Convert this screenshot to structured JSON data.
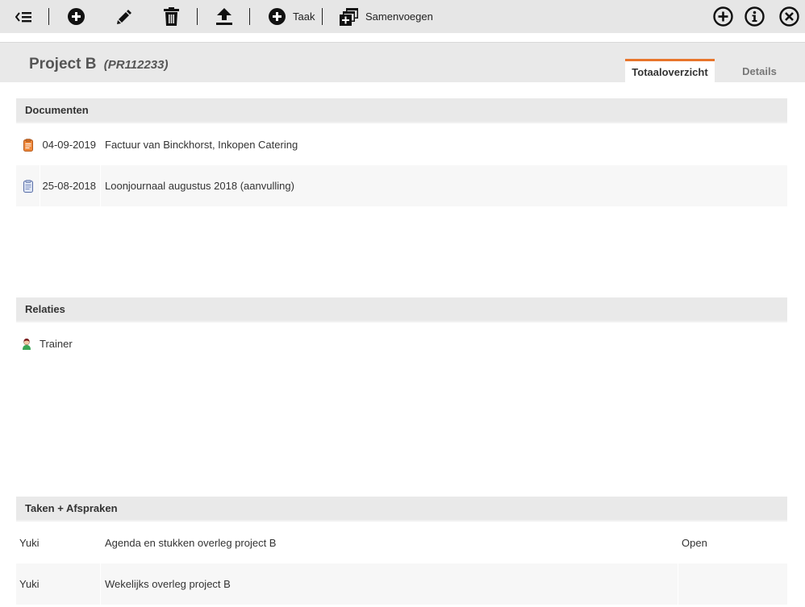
{
  "toolbar": {
    "task_label": "Taak",
    "merge_label": "Samenvoegen"
  },
  "header": {
    "title": "Project B",
    "code": "(PR112233)",
    "tabs": [
      {
        "label": "Totaaloverzicht",
        "active": true
      },
      {
        "label": "Details",
        "active": false
      }
    ]
  },
  "documents": {
    "heading": "Documenten",
    "rows": [
      {
        "date": "04-09-2019",
        "description": "Factuur van Binckhorst, Inkopen Catering",
        "icon": "invoice-document-icon"
      },
      {
        "date": "25-08-2018",
        "description": "Loonjournaal augustus 2018 (aanvulling)",
        "icon": "journal-document-icon"
      }
    ]
  },
  "relations": {
    "heading": "Relaties",
    "rows": [
      {
        "name": "Trainer",
        "icon": "person-icon"
      }
    ]
  },
  "tasks": {
    "heading": "Taken + Afspraken",
    "rows": [
      {
        "owner": "Yuki",
        "description": "Agenda en stukken overleg project B",
        "status": "Open"
      },
      {
        "owner": "Yuki",
        "description": "Wekelijks overleg project B",
        "status": ""
      }
    ]
  },
  "colors": {
    "accent": "#e8752b",
    "toolbar_bg": "#e6e6e6",
    "section_bg": "#e9e9e9"
  }
}
